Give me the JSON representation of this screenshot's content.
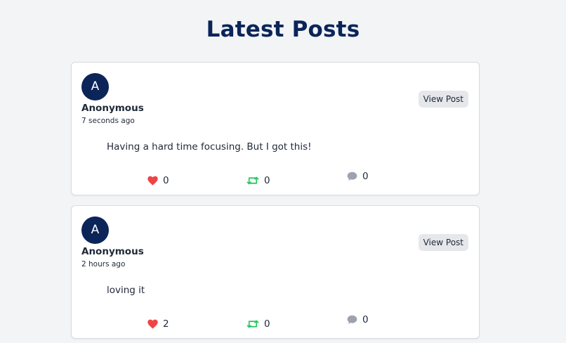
{
  "page": {
    "title": "Latest Posts"
  },
  "colors": {
    "brand_navy": "#0b2559",
    "like_red": "#ef4444",
    "repost_green": "#22c55e",
    "comment_gray": "#9ca3af",
    "page_background": "#f3f4f6"
  },
  "posts": [
    {
      "avatar_initial": "A",
      "author": "Anonymous",
      "timestamp": "7 seconds ago",
      "view_label": "View Post",
      "content": "Having a hard time focusing. But I got this!",
      "likes": "0",
      "reposts": "0",
      "comments": "0"
    },
    {
      "avatar_initial": "A",
      "author": "Anonymous",
      "timestamp": "2 hours ago",
      "view_label": "View Post",
      "content": "loving it",
      "likes": "2",
      "reposts": "0",
      "comments": "0"
    }
  ],
  "icons": [
    "heart-icon",
    "repost-icon",
    "comment-icon"
  ]
}
